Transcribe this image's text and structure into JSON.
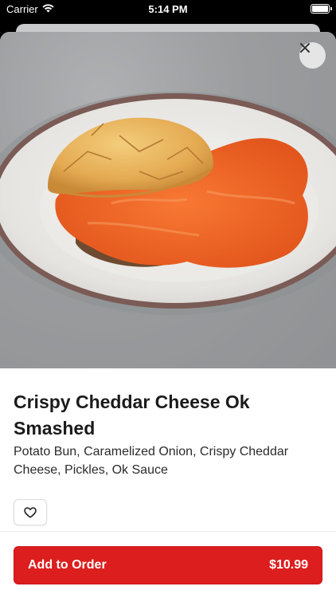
{
  "status_bar": {
    "carrier": "Carrier",
    "time": "5:14 PM"
  },
  "item": {
    "title": "Crispy Cheddar Cheese Ok Smashed",
    "description": "Potato Bun, Caramelized Onion, Crispy Cheddar Cheese, Pickles, Ok Sauce",
    "price": "$10.99"
  },
  "actions": {
    "add_to_order_label": "Add to Order"
  },
  "colors": {
    "accent": "#dd1e1e"
  },
  "icons": {
    "close": "close-icon",
    "favorite": "heart-icon",
    "wifi": "wifi-icon",
    "battery": "battery-icon"
  }
}
